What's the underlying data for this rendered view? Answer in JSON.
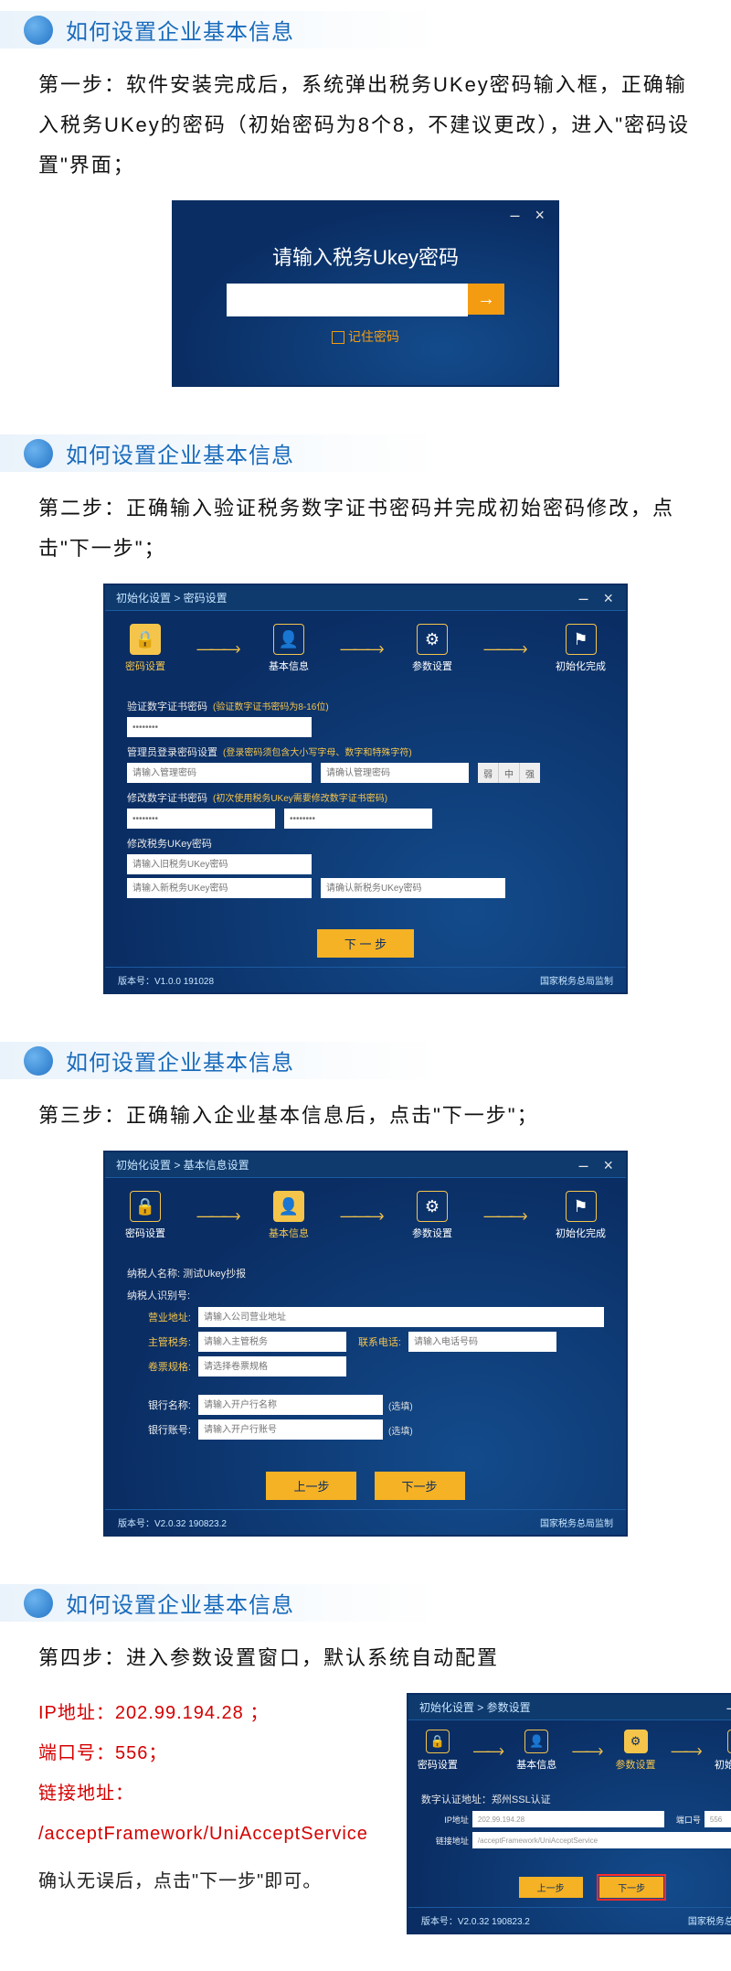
{
  "sectionTitle": "如何设置企业基本信息",
  "step1": {
    "text": "第一步：软件安装完成后，系统弹出税务UKey密码输入框，正确输入税务UKey的密码（初始密码为8个8，不建议更改），进入\"密码设置\"界面；",
    "dialog": {
      "title": "请输入税务Ukey密码",
      "remember": "记住密码",
      "arrow": "→"
    }
  },
  "wizardSteps": [
    {
      "icon": "🔒",
      "label": "密码设置"
    },
    {
      "icon": "👤",
      "label": "基本信息"
    },
    {
      "icon": "⚙",
      "label": "参数设置"
    },
    {
      "icon": "⚑",
      "label": "初始化完成"
    }
  ],
  "footerRight": "国家税务总局监制",
  "step2": {
    "text": "第二步：正确输入验证税务数字证书密码并完成初始密码修改，点击\"下一步\"；",
    "breadcrumb": "初始化设置 > 密码设置",
    "sec1": {
      "label": "验证数字证书密码",
      "hint": "(验证数字证书密码为8-16位)",
      "ph": "••••••••"
    },
    "sec2": {
      "label": "管理员登录密码设置",
      "hint": "(登录密码须包含大小写字母、数字和特殊字符)",
      "ph1": "请输入管理密码",
      "ph2": "请确认管理密码",
      "strength": [
        "弱",
        "中",
        "强"
      ]
    },
    "sec3": {
      "label": "修改数字证书密码",
      "hint": "(初次使用税务UKey需要修改数字证书密码)",
      "ph1": "••••••••",
      "ph2": "••••••••"
    },
    "sec4": {
      "label": "修改税务UKey密码",
      "ph1": "请输入旧税务UKey密码",
      "ph2": "请输入新税务UKey密码",
      "ph3": "请确认新税务UKey密码"
    },
    "btn": "下 一 步",
    "version": "版本号：V1.0.0 191028"
  },
  "step3": {
    "text": "第三步：正确输入企业基本信息后，点击\"下一步\"；",
    "breadcrumb": "初始化设置 > 基本信息设置",
    "taxpayerNameLbl": "纳税人名称: 测试Ukey抄报",
    "taxpayerIdLbl": "纳税人识别号:",
    "fields": {
      "addr": {
        "lbl": "营业地址:",
        "ph": "请输入公司营业地址"
      },
      "authority": {
        "lbl": "主管税务:",
        "ph": "请输入主管税务"
      },
      "phone": {
        "lbl": "联系电话:",
        "ph": "请输入电话号码"
      },
      "scale": {
        "lbl": "卷票规格:",
        "ph": "请选择卷票规格"
      },
      "bank": {
        "lbl": "银行名称:",
        "ph": "请输入开户行名称",
        "suffix": "(选填)"
      },
      "account": {
        "lbl": "银行账号:",
        "ph": "请输入开户行账号",
        "suffix": "(选填)"
      }
    },
    "btnPrev": "上一步",
    "btnNext": "下一步",
    "version": "版本号：V2.0.32 190823.2"
  },
  "step4": {
    "text": "第四步：进入参数设置窗口，默认系统自动配置",
    "ipLabel": "IP地址：202.99.194.28 ；",
    "portLabel": "端口号：556；",
    "linkLabel": "链接地址：",
    "linkValue": "/acceptFramework/UniAcceptService",
    "confirm": "确认无误后，点击\"下一步\"即可。",
    "breadcrumb": "初始化设置 > 参数设置",
    "params": {
      "certLbl": "数字认证地址：郑州SSL认证",
      "ipLbl": "IP地址",
      "ipVal": "202.99.194.28",
      "portLbl": "端口号",
      "portVal": "556",
      "linkLbl": "链接地址",
      "linkVal": "/acceptFramework/UniAcceptService"
    },
    "btnPrev": "上一步",
    "btnNext": "下一步",
    "version": "版本号：V2.0.32 190823.2"
  }
}
